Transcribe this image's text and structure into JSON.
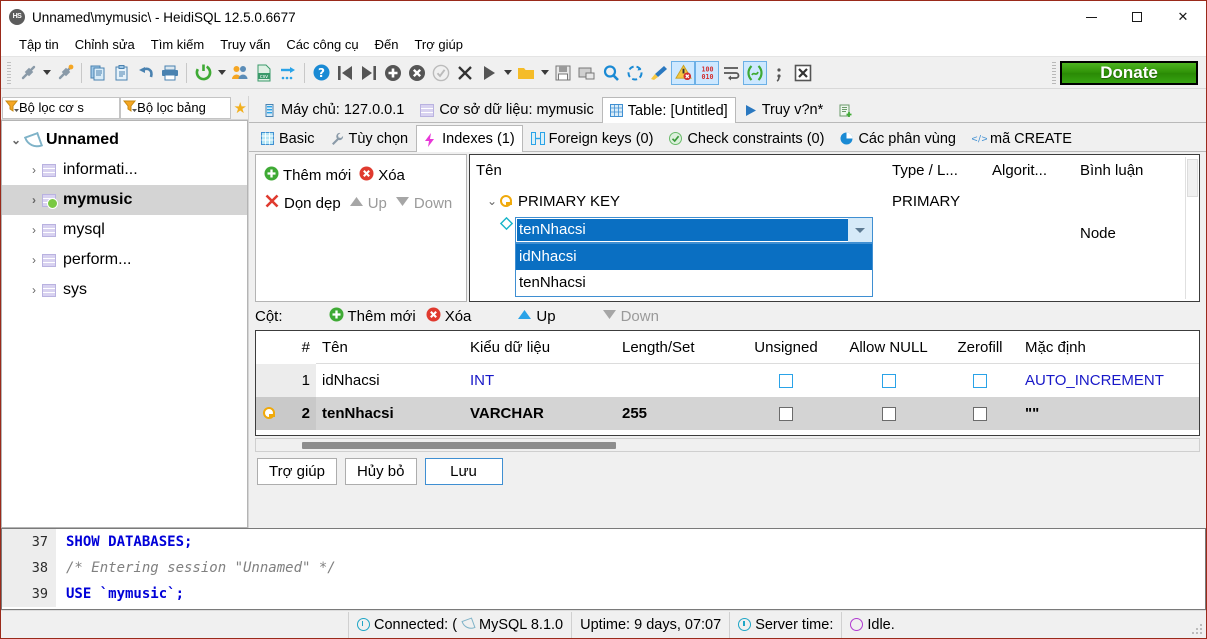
{
  "window": {
    "title": "Unnamed\\mymusic\\ - HeidiSQL 12.5.0.6677",
    "app_icon": "HS",
    "minimize": "—",
    "maximize": "□",
    "close": "✕"
  },
  "menu": {
    "items": [
      {
        "label": "Tập tin"
      },
      {
        "label": "Chỉnh sửa"
      },
      {
        "label": "Tìm kiếm"
      },
      {
        "label": "Truy vấn"
      },
      {
        "label": "Các công cụ"
      },
      {
        "label": "Đến"
      },
      {
        "label": "Trợ giúp"
      }
    ]
  },
  "toolbar": {
    "donate_label": "Donate",
    "buttons": [
      {
        "name": "session-manager-icon",
        "glyph": "🔌"
      },
      {
        "name": "new-session-icon",
        "glyph": "🔌"
      },
      {
        "name": "copy-icon",
        "glyph": "📄"
      },
      {
        "name": "paste-icon",
        "glyph": "📋"
      },
      {
        "name": "undo-icon",
        "glyph": "↶"
      },
      {
        "name": "print-icon",
        "glyph": "🖨"
      },
      {
        "name": "refresh-icon",
        "glyph": "⟳"
      },
      {
        "name": "user-manager-icon",
        "glyph": "👥"
      },
      {
        "name": "export-csv-icon",
        "glyph": "CSV"
      },
      {
        "name": "import-icon",
        "glyph": "→"
      },
      {
        "name": "help-icon",
        "glyph": "?"
      },
      {
        "name": "first-page-icon",
        "glyph": "⏮"
      },
      {
        "name": "last-page-icon",
        "glyph": "⏭"
      },
      {
        "name": "insert-row-icon",
        "glyph": "+"
      },
      {
        "name": "delete-row-icon",
        "glyph": "✕"
      },
      {
        "name": "commit-icon",
        "glyph": "✓"
      },
      {
        "name": "cancel-icon",
        "glyph": "✕"
      },
      {
        "name": "execute-query-icon",
        "glyph": "▶"
      },
      {
        "name": "open-folder-icon",
        "glyph": "📁"
      },
      {
        "name": "save-icon",
        "glyph": "💾"
      },
      {
        "name": "save-as-icon",
        "glyph": "💾"
      },
      {
        "name": "find-icon",
        "glyph": "🔍"
      },
      {
        "name": "replace-icon",
        "glyph": "⟲"
      },
      {
        "name": "clean-icon",
        "glyph": "🧹"
      },
      {
        "name": "warning-icon",
        "glyph": "⚠"
      },
      {
        "name": "binary-icon",
        "glyph": "100\n010"
      },
      {
        "name": "word-wrap-icon",
        "glyph": "↵"
      },
      {
        "name": "format-sql-icon",
        "glyph": "( )"
      },
      {
        "name": "semicolon-icon",
        "glyph": ";"
      },
      {
        "name": "stop-icon",
        "glyph": "✕"
      }
    ]
  },
  "sidebar": {
    "filter_host": "Bộ lọc cơ s",
    "filter_table": "Bộ lọc bảng",
    "favorites_icon": "star-icon",
    "tree": [
      {
        "label": "Unnamed",
        "depth": 0,
        "icon": "connection-icon",
        "selected": false,
        "bold": true,
        "expanded": true
      },
      {
        "label": "informati...",
        "depth": 1,
        "icon": "database-icon",
        "selected": false,
        "bold": false
      },
      {
        "label": "mymusic",
        "depth": 1,
        "icon": "database-active-icon",
        "selected": true,
        "bold": true
      },
      {
        "label": "mysql",
        "depth": 1,
        "icon": "database-icon",
        "selected": false,
        "bold": false
      },
      {
        "label": "perform...",
        "depth": 1,
        "icon": "database-icon",
        "selected": false,
        "bold": false
      },
      {
        "label": "sys",
        "depth": 1,
        "icon": "database-icon",
        "selected": false,
        "bold": false
      }
    ]
  },
  "top_tabs": [
    {
      "label": "Máy chủ: 127.0.0.1",
      "icon": "host-icon",
      "selected": false
    },
    {
      "label": "Cơ sở dữ liệu: mymusic",
      "icon": "database-icon",
      "selected": false
    },
    {
      "label": "Table: [Untitled]",
      "icon": "table-icon",
      "selected": true
    },
    {
      "label": "Truy v?n*",
      "icon": "query-play-icon",
      "selected": false
    },
    {
      "label": "",
      "icon": "new-query-tab-icon",
      "selected": false
    }
  ],
  "sub_tabs": [
    {
      "label": "Basic",
      "icon": "grid-icon",
      "selected": false
    },
    {
      "label": "Tùy chọn",
      "icon": "wrench-icon",
      "selected": false
    },
    {
      "label": "Indexes (1)",
      "icon": "lightning-icon",
      "selected": true
    },
    {
      "label": "Foreign keys (0)",
      "icon": "foreign-key-icon",
      "selected": false
    },
    {
      "label": "Check constraints (0)",
      "icon": "check-icon",
      "selected": false
    },
    {
      "label": "Các phân vùng",
      "icon": "pie-icon",
      "selected": false
    },
    {
      "label": "mã CREATE",
      "icon": "code-icon",
      "selected": false
    }
  ],
  "index_panel": {
    "buttons": [
      {
        "label": "Thêm mới",
        "icon": "add-green-icon",
        "enabled": true
      },
      {
        "label": "Xóa",
        "icon": "delete-red-icon",
        "enabled": true
      },
      {
        "label": "Dọn dẹp",
        "icon": "clear-x-icon",
        "enabled": true
      },
      {
        "label": "Up",
        "icon": "arrow-up-icon",
        "enabled": false
      },
      {
        "label": "Down",
        "icon": "arrow-down-icon",
        "enabled": false
      }
    ],
    "columns": [
      "Tên",
      "Type / L...",
      "Algorit...",
      "Bình luận"
    ],
    "rows": [
      {
        "name": "PRIMARY KEY",
        "type": "PRIMARY",
        "algorithm": "",
        "comment": "",
        "icon": "key-icon",
        "expanded": true
      },
      {
        "name": "tenNhacsi",
        "type": "",
        "algorithm": "",
        "comment": "Node",
        "icon": "diamond-icon",
        "editing": true
      }
    ],
    "combo": {
      "value": "tenNhacsi",
      "options": [
        {
          "label": "idNhacsi",
          "highlighted": true
        },
        {
          "label": "tenNhacsi",
          "highlighted": false
        }
      ]
    }
  },
  "columns_panel": {
    "label": "Cột:",
    "buttons": [
      {
        "label": "Thêm mới",
        "icon": "add-green-icon",
        "enabled": true
      },
      {
        "label": "Xóa",
        "icon": "delete-red-icon",
        "enabled": true
      },
      {
        "label": "Up",
        "icon": "arrow-up-icon",
        "enabled": true
      },
      {
        "label": "Down",
        "icon": "arrow-down-icon",
        "enabled": false
      }
    ],
    "headers": [
      "#",
      "Tên",
      "Kiểu dữ liệu",
      "Length/Set",
      "Unsigned",
      "Allow NULL",
      "Zerofill",
      "Mặc định"
    ],
    "rows": [
      {
        "key": false,
        "num": "1",
        "name": "idNhacsi",
        "type": "INT",
        "length": "",
        "unsigned": false,
        "allow_null": false,
        "zerofill": false,
        "default": "AUTO_INCREMENT",
        "selected": false
      },
      {
        "key": true,
        "num": "2",
        "name": "tenNhacsi",
        "type": "VARCHAR",
        "length": "255",
        "unsigned": false,
        "allow_null": false,
        "zerofill": false,
        "default": "\"\"",
        "selected": true
      }
    ]
  },
  "footer_buttons": [
    {
      "label": "Trợ giúp",
      "primary": false
    },
    {
      "label": "Hủy bỏ",
      "primary": false
    },
    {
      "label": "Lưu",
      "primary": true
    }
  ],
  "sql_log": {
    "lines": [
      {
        "num": "37",
        "text": "SHOW DATABASES;",
        "style": "keyword"
      },
      {
        "num": "38",
        "text": "/* Entering session \"Unnamed\" */",
        "style": "comment"
      },
      {
        "num": "39",
        "text": "USE `mymusic`;",
        "style": "keyword"
      }
    ]
  },
  "status_bar": {
    "connected": "Connected: (",
    "server": "MySQL 8.1.0",
    "uptime": "Uptime: 9 days, 07:07",
    "server_time": "Server time:",
    "idle": "Idle."
  },
  "colors": {
    "accent_blue": "#0a6fc2",
    "selection_grey": "#d4d4d4",
    "sql_keyword": "#0000d8",
    "sql_comment": "#808080",
    "donate_green": "#2f9207",
    "key_orange": "#f0a90a",
    "checkbox_blue": "#2aa3e8"
  }
}
